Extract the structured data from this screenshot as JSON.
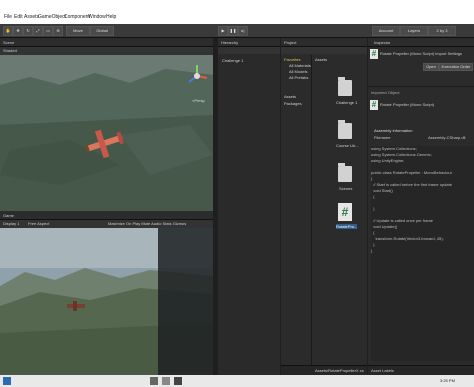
{
  "menubar": {
    "items": [
      "File",
      "Edit",
      "Assets",
      "GameObject",
      "Component",
      "Window",
      "Help"
    ]
  },
  "toolbar": {
    "move": "Move",
    "global": "Global",
    "account": "Account",
    "layers": "Layers",
    "layout": "2 by 3"
  },
  "scene": {
    "tab": "Scene",
    "shaded": "Shaded",
    "gizmo_label": "<Persp"
  },
  "game": {
    "tab": "Game",
    "display": "Display 1",
    "aspect": "Free Aspect",
    "options": "Maximize On Play   Mute Audio   Stats   Gizmos"
  },
  "hierarchy": {
    "tab": "Hierarchy",
    "scene_item": "Challenge 1"
  },
  "project": {
    "tab": "Project",
    "favorites": "Favorites",
    "fav_items": [
      "All Materials",
      "All Models",
      "All Prefabs"
    ],
    "assets": "Assets",
    "packages": "Packages",
    "breadcrumb": "Assets",
    "files": [
      "Challenge 1",
      "Course Lib...",
      "Scenes",
      "RotatePro..."
    ],
    "footer": "Assets/RotatePropellerX.cs"
  },
  "inspector": {
    "tab": "Inspector",
    "script_title": "Rotate Propeller (Mono Script) Import Settings",
    "open": "Open",
    "exec_order": "Execution Order",
    "imported_object": "Imported Object",
    "imported_name": "Rotate Propeller (Mono Script)",
    "assembly_info": "Assembly Information",
    "filename_label": "Filename",
    "filename_value": "Assembly-CSharp.dll",
    "code": "using System.Collections;\nusing System.Collections.Generic;\nusing UnityEngine;\n\npublic class RotatePropeller : MonoBehaviour\n{\n  // Start is called before the first frame update\n  void Start()\n  {\n\n  }\n\n  // Update is called once per frame\n  void Update()\n  {\n    transform.Rotate(Vector3.forward, 45);\n  }\n}",
    "asset_labels": "Asset Labels"
  },
  "taskbar": {
    "time": "3:25 PM"
  },
  "colors": {
    "sky": "#8fa1ab",
    "terrain": "#465a49",
    "menubar": "#ffffff"
  }
}
